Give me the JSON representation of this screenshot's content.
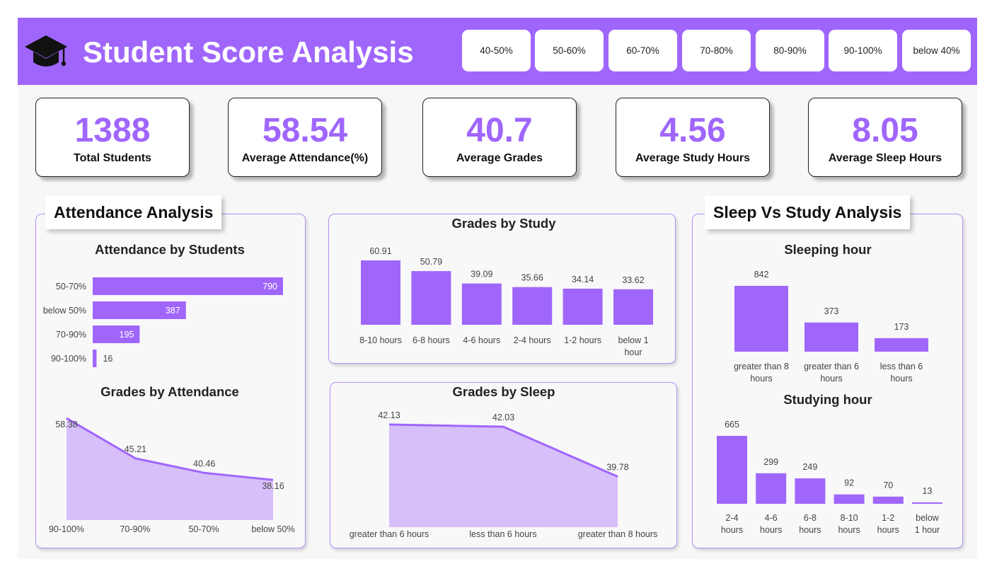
{
  "header": {
    "title": "Student Score Analysis",
    "icon": "graduation-cap-icon",
    "filters": [
      "40-50%",
      "50-60%",
      "60-70%",
      "70-80%",
      "80-90%",
      "90-100%",
      "below 40%"
    ]
  },
  "kpis": [
    {
      "value": "1388",
      "label": "Total Students"
    },
    {
      "value": "58.54",
      "label": "Average Attendance(%)"
    },
    {
      "value": "40.7",
      "label": "Average Grades"
    },
    {
      "value": "4.56",
      "label": "Average Study Hours"
    },
    {
      "value": "8.05",
      "label": "Average Sleep Hours"
    }
  ],
  "sections": {
    "attendance": "Attendance Analysis",
    "sleep_study": "Sleep Vs Study Analysis"
  },
  "colors": {
    "accent": "#a066fc",
    "area_fill": "#d7bffa",
    "header_text": "#ffffff"
  },
  "chart_data": [
    {
      "id": "attendance_by_students",
      "type": "bar",
      "orientation": "horizontal",
      "title": "Attendance by Students",
      "categories": [
        "50-70%",
        "below 50%",
        "70-90%",
        "90-100%"
      ],
      "values": [
        790,
        387,
        195,
        16
      ]
    },
    {
      "id": "grades_by_attendance",
      "type": "area",
      "title": "Grades by Attendance",
      "categories": [
        "90-100%",
        "70-90%",
        "50-70%",
        "below 50%"
      ],
      "values": [
        58.38,
        45.21,
        40.46,
        38.16
      ]
    },
    {
      "id": "grades_by_study",
      "type": "bar",
      "title": "Grades by Study",
      "categories": [
        "8-10 hours",
        "6-8 hours",
        "4-6 hours",
        "2-4 hours",
        "1-2 hours",
        "below 1 hour"
      ],
      "values": [
        60.91,
        50.79,
        39.09,
        35.66,
        34.14,
        33.62
      ]
    },
    {
      "id": "grades_by_sleep",
      "type": "area",
      "title": "Grades by Sleep",
      "categories": [
        "greater than 6 hours",
        "less than 6 hours",
        "greater than 8 hours"
      ],
      "values": [
        42.13,
        42.03,
        39.78
      ]
    },
    {
      "id": "sleeping_hour",
      "type": "bar",
      "title": "Sleeping hour",
      "categories": [
        "greater than 8 hours",
        "greater than 6 hours",
        "less than 6 hours"
      ],
      "values": [
        842,
        373,
        173
      ]
    },
    {
      "id": "studying_hour",
      "type": "bar",
      "title": "Studying hour",
      "categories": [
        "2-4 hours",
        "4-6 hours",
        "6-8 hours",
        "8-10 hours",
        "1-2 hours",
        "below 1 hour"
      ],
      "values": [
        665,
        299,
        249,
        92,
        70,
        13
      ]
    }
  ]
}
